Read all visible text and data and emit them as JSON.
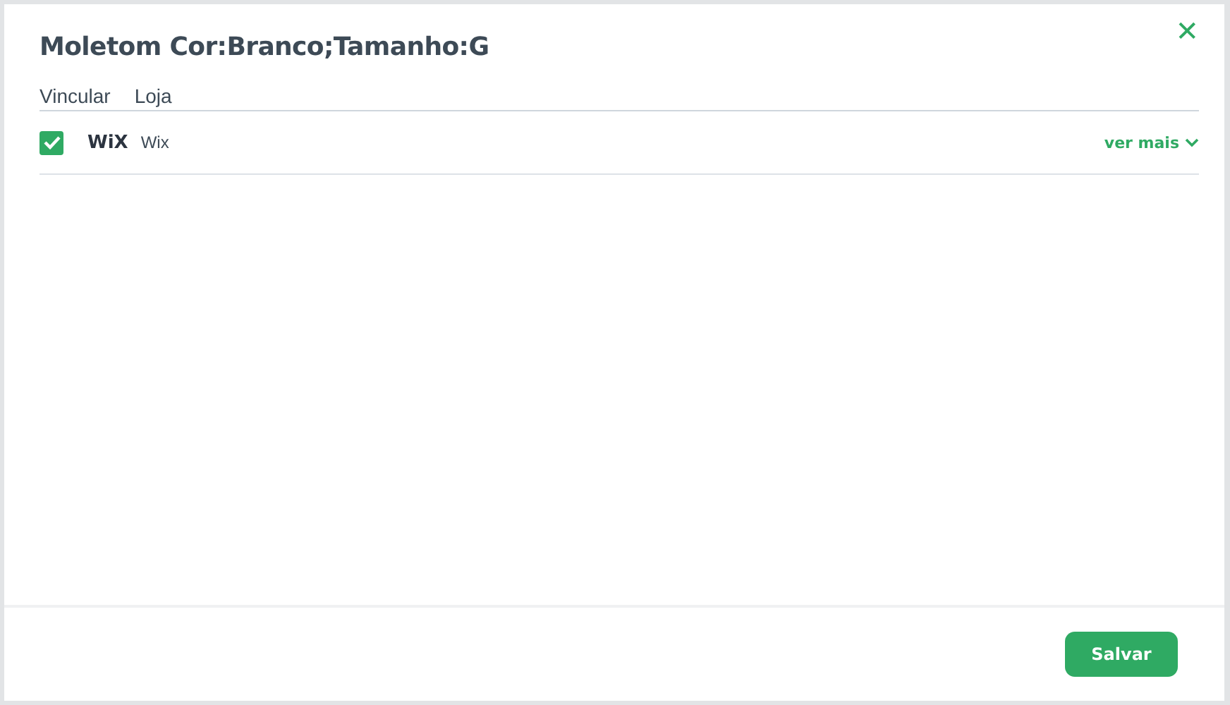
{
  "modal": {
    "title": "Moletom Cor:Branco;Tamanho:G",
    "close": "✕"
  },
  "table": {
    "columns": [
      "Vincular",
      "Loja"
    ],
    "rows": [
      {
        "checked": true,
        "logo": "WiX",
        "store": "Wix",
        "more": "ver mais",
        "expanded": false
      }
    ]
  },
  "footer": {
    "button": "Salvar"
  }
}
